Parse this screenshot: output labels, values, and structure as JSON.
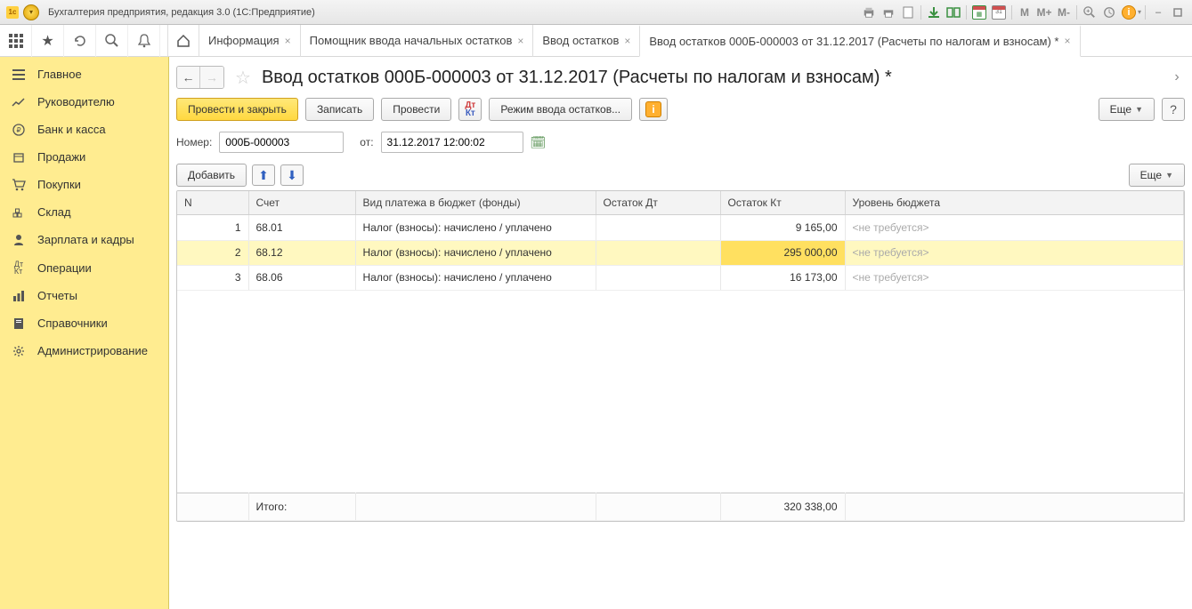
{
  "window": {
    "title": "Бухгалтерия предприятия, редакция 3.0  (1С:Предприятие)"
  },
  "tabs": [
    {
      "label": "Информация"
    },
    {
      "label": "Помощник ввода начальных остатков"
    },
    {
      "label": "Ввод остатков"
    },
    {
      "label": "Ввод остатков 000Б-000003 от 31.12.2017 (Расчеты по налогам и взносам) *",
      "active": true
    }
  ],
  "sidebar": [
    {
      "icon": "menu",
      "label": "Главное"
    },
    {
      "icon": "trend",
      "label": "Руководителю"
    },
    {
      "icon": "ruble",
      "label": "Банк и касса"
    },
    {
      "icon": "box",
      "label": "Продажи"
    },
    {
      "icon": "cart",
      "label": "Покупки"
    },
    {
      "icon": "stock",
      "label": "Склад"
    },
    {
      "icon": "person",
      "label": "Зарплата и кадры"
    },
    {
      "icon": "dtKt",
      "label": "Операции"
    },
    {
      "icon": "bars",
      "label": "Отчеты"
    },
    {
      "icon": "book",
      "label": "Справочники"
    },
    {
      "icon": "gear",
      "label": "Администрирование"
    }
  ],
  "doc": {
    "title": "Ввод остатков 000Б-000003 от 31.12.2017 (Расчеты по налогам и взносам) *",
    "actions": {
      "post_close": "Провести и закрыть",
      "save": "Записать",
      "post": "Провести",
      "mode": "Режим ввода остатков...",
      "more": "Еще"
    },
    "number_label": "Номер:",
    "number": "000Б-000003",
    "date_label": "от:",
    "date": "31.12.2017 12:00:02"
  },
  "table": {
    "add": "Добавить",
    "more": "Еще",
    "headers": {
      "n": "N",
      "acc": "Счет",
      "type": "Вид платежа в бюджет (фонды)",
      "dt": "Остаток Дт",
      "kt": "Остаток Кт",
      "lvl": "Уровень бюджета"
    },
    "rows": [
      {
        "n": "1",
        "acc": "68.01",
        "type": "Налог (взносы): начислено / уплачено",
        "dt": "",
        "kt": "9 165,00",
        "lvl": "<не требуется>",
        "selected": false
      },
      {
        "n": "2",
        "acc": "68.12",
        "type": "Налог (взносы): начислено / уплачено",
        "dt": "",
        "kt": "295 000,00",
        "lvl": "<не требуется>",
        "selected": true
      },
      {
        "n": "3",
        "acc": "68.06",
        "type": "Налог (взносы): начислено / уплачено",
        "dt": "",
        "kt": "16 173,00",
        "lvl": "<не требуется>",
        "selected": false
      }
    ],
    "footer": {
      "label": "Итого:",
      "kt": "320 338,00"
    }
  },
  "toolbar_icons": {
    "m": "M",
    "mplus": "M+",
    "mminus": "M-"
  }
}
